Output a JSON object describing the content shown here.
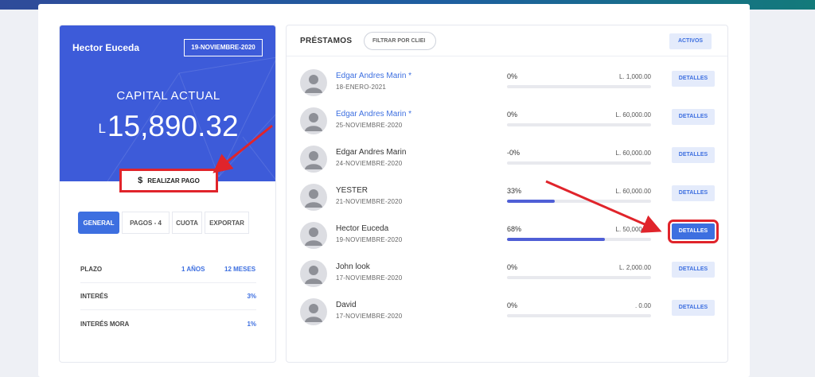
{
  "colors": {
    "accent": "#3d6fe0",
    "hero": "#3d5bd9",
    "annotation": "#e0242b",
    "progress": "#4f5fd6"
  },
  "summary": {
    "user_name": "Hector Euceda",
    "date": "19-NOVIEMBRE-2020",
    "capital_label": "CAPITAL ACTUAL",
    "currency": "L",
    "capital_value": "15,890.32",
    "pay_icon": "$",
    "pay_label": "REALIZAR PAGO"
  },
  "tabs": [
    "GENERAL",
    "PAGOS - 4",
    "CUOTA",
    "EXPORTAR"
  ],
  "info": {
    "plazo_label": "PLAZO",
    "plazo_years": "1 AÑOS",
    "plazo_months": "12 MESES",
    "interes_label": "INTERÉS",
    "interes_value": "3%",
    "mora_label": "INTERÉS MORA",
    "mora_value": "1%"
  },
  "loans_panel": {
    "title": "PRÉSTAMOS",
    "filter_placeholder": "FILTRAR POR CLIEI",
    "active_button": "ACTIVOS",
    "details_label": "DETALLES"
  },
  "loans": [
    {
      "name": "Edgar Andres Marin *",
      "date": "18-ENERO-2021",
      "percent": "0%",
      "progress": 0,
      "amount": "L. 1,000.00",
      "link": true
    },
    {
      "name": "Edgar Andres Marin *",
      "date": "25-NOVIEMBRE-2020",
      "percent": "0%",
      "progress": 0,
      "amount": "L. 60,000.00",
      "link": true
    },
    {
      "name": "Edgar Andres Marin",
      "date": "24-NOVIEMBRE-2020",
      "percent": "-0%",
      "progress": 0,
      "amount": "L. 60,000.00",
      "link": false
    },
    {
      "name": "YESTER",
      "date": "21-NOVIEMBRE-2020",
      "percent": "33%",
      "progress": 33,
      "amount": "L. 60,000.00",
      "link": false
    },
    {
      "name": "Hector Euceda",
      "date": "19-NOVIEMBRE-2020",
      "percent": "68%",
      "progress": 68,
      "amount": "L. 50,000.00",
      "link": false,
      "highlighted": true
    },
    {
      "name": "John look",
      "date": "17-NOVIEMBRE-2020",
      "percent": "0%",
      "progress": 0,
      "amount": "L. 2,000.00",
      "link": false
    },
    {
      "name": "David",
      "date": "17-NOVIEMBRE-2020",
      "percent": "0%",
      "progress": 0,
      "amount": ". 0.00",
      "link": false
    }
  ]
}
